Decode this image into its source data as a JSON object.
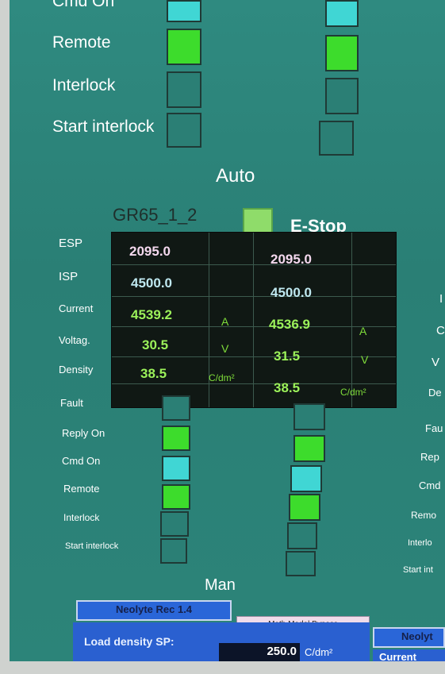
{
  "top_section": {
    "labels": [
      "Cmd On",
      "Remote",
      "Interlock",
      "Start interlock"
    ]
  },
  "auto_label": "Auto",
  "unit_name": "GR65_1_2",
  "estop_label": "E-Stop",
  "table": {
    "row_labels": [
      "ESP",
      "ISP",
      "Current",
      "Voltag.",
      "Density"
    ],
    "left": {
      "esp": "2095.0",
      "isp": "4500.0",
      "current": "4539.2",
      "current_unit": "A",
      "voltage": "30.5",
      "voltage_unit": "V",
      "density": "38.5",
      "density_unit": "C/dm²"
    },
    "right": {
      "esp": "2095.0",
      "isp": "4500.0",
      "current": "4536.9",
      "current_unit": "A",
      "voltage": "31.5",
      "voltage_unit": "V",
      "density": "38.5",
      "density_unit": "C/dm²"
    }
  },
  "bottom_section": {
    "labels": [
      "Fault",
      "Reply On",
      "Cmd On",
      "Remote",
      "Interlock",
      "Start interlock"
    ],
    "right_cut_labels": [
      "I",
      "C",
      "V",
      "De",
      "Fau",
      "Rep",
      "Cmd",
      "Remo",
      "Interlo",
      "Start int"
    ]
  },
  "man_label": "Man",
  "buttons": {
    "neolyte_rec": "Neolyte Rec 1.4",
    "math_model_bypass": "Math Model Bypass",
    "neolyte_cut": "Neolyt"
  },
  "load_density": {
    "label": "Load density SP:",
    "value": "250.0",
    "unit": "C/dm²",
    "right_cut_label": "Current"
  },
  "indicator_colors": {
    "off": "#2b7f75",
    "green": "#3ddc2c",
    "cyan": "#40d6d4",
    "estop": "#8fdc6a"
  }
}
